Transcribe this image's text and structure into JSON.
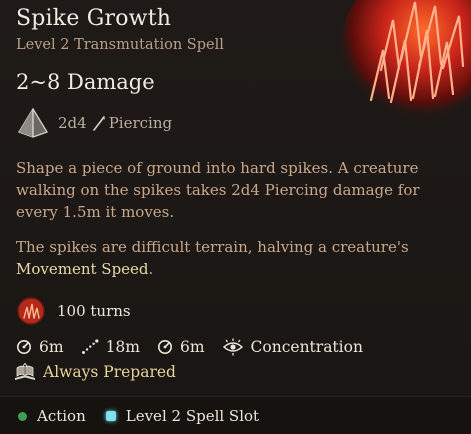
{
  "spell": {
    "name": "Spike Growth",
    "subtitle": "Level 2 Transmutation Spell",
    "damage": "2~8 Damage",
    "dice": "2d4",
    "damage_type": "Piercing"
  },
  "description": {
    "p1": "Shape a piece of ground into hard spikes. A creature walking on the spikes takes 2d4 Piercing damage for every 1.5m it moves.",
    "p2_before": "The spikes are difficult terrain, halving a creature's",
    "p2_highlight": "Movement Speed",
    "p2_after": "."
  },
  "duration": "100 turns",
  "stats": {
    "range": "6m",
    "reach": "18m",
    "radius": "6m",
    "concentration": "Concentration"
  },
  "prepared": "Always Prepared",
  "footer": {
    "action": "Action",
    "slot": "Level 2 Spell Slot"
  },
  "colors": {
    "action_dot": "#3f9e4f",
    "spell_slot": "#7fe0f0",
    "highlight": "#e9d9a8",
    "description": "#c8a88c"
  }
}
